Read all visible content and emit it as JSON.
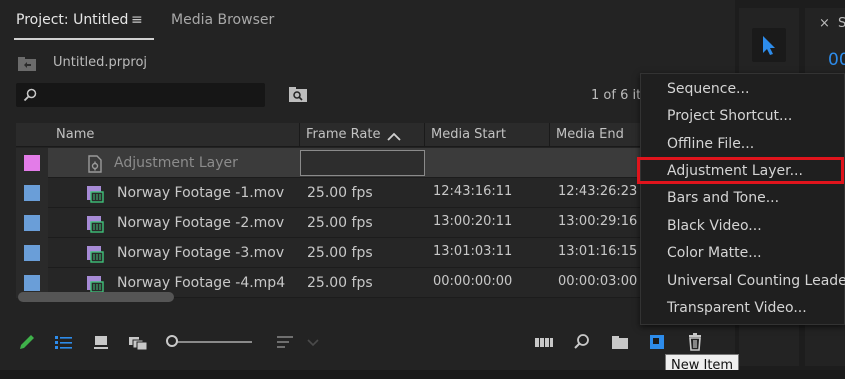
{
  "tabs": {
    "project": "Project: Untitled",
    "media_browser": "Media Browser"
  },
  "project": {
    "filename": "Untitled.prproj",
    "item_count": "1 of 6 it"
  },
  "table": {
    "headers": {
      "name": "Name",
      "frame_rate": "Frame Rate",
      "media_start": "Media Start",
      "media_end": "Media End"
    },
    "rows": [
      {
        "label_color": "#e37ce8",
        "icon": "adjustment-layer-icon",
        "name": "Adjustment Layer",
        "frame_rate": "",
        "media_start": "",
        "media_end": ""
      },
      {
        "label_color": "#6a9ed8",
        "icon": "video-clip-icon",
        "name": "Norway Footage -1.mov",
        "frame_rate": "25.00 fps",
        "media_start": "12:43:16:11",
        "media_end": "12:43:26:23"
      },
      {
        "label_color": "#6a9ed8",
        "icon": "video-clip-icon",
        "name": "Norway Footage -2.mov",
        "frame_rate": "25.00 fps",
        "media_start": "13:00:20:11",
        "media_end": "13:00:29:16"
      },
      {
        "label_color": "#6a9ed8",
        "icon": "video-clip-icon",
        "name": "Norway Footage -3.mov",
        "frame_rate": "25.00 fps",
        "media_start": "13:01:03:11",
        "media_end": "13:01:16:15"
      },
      {
        "label_color": "#6a9ed8",
        "icon": "video-clip-icon",
        "name": "Norway Footage -4.mp4",
        "frame_rate": "25.00 fps",
        "media_start": "00:00:00:00",
        "media_end": "00:00:03:00"
      }
    ]
  },
  "menu": {
    "items": [
      "Sequence...",
      "Project Shortcut...",
      "Offline File...",
      "Adjustment Layer...",
      "Bars and Tone...",
      "Black Video...",
      "Color Matte...",
      "Universal Counting Leader...",
      "Transparent Video..."
    ],
    "highlighted": "Adjustment Layer...",
    "highlight_color": "#e0141c"
  },
  "tooltip": "New Item",
  "right_panel": {
    "close": "×",
    "title_fragment": "S",
    "timecode_fragment": "00"
  },
  "colors": {
    "accent_blue": "#2d8ceb",
    "pencil_green": "#3fb24a"
  }
}
